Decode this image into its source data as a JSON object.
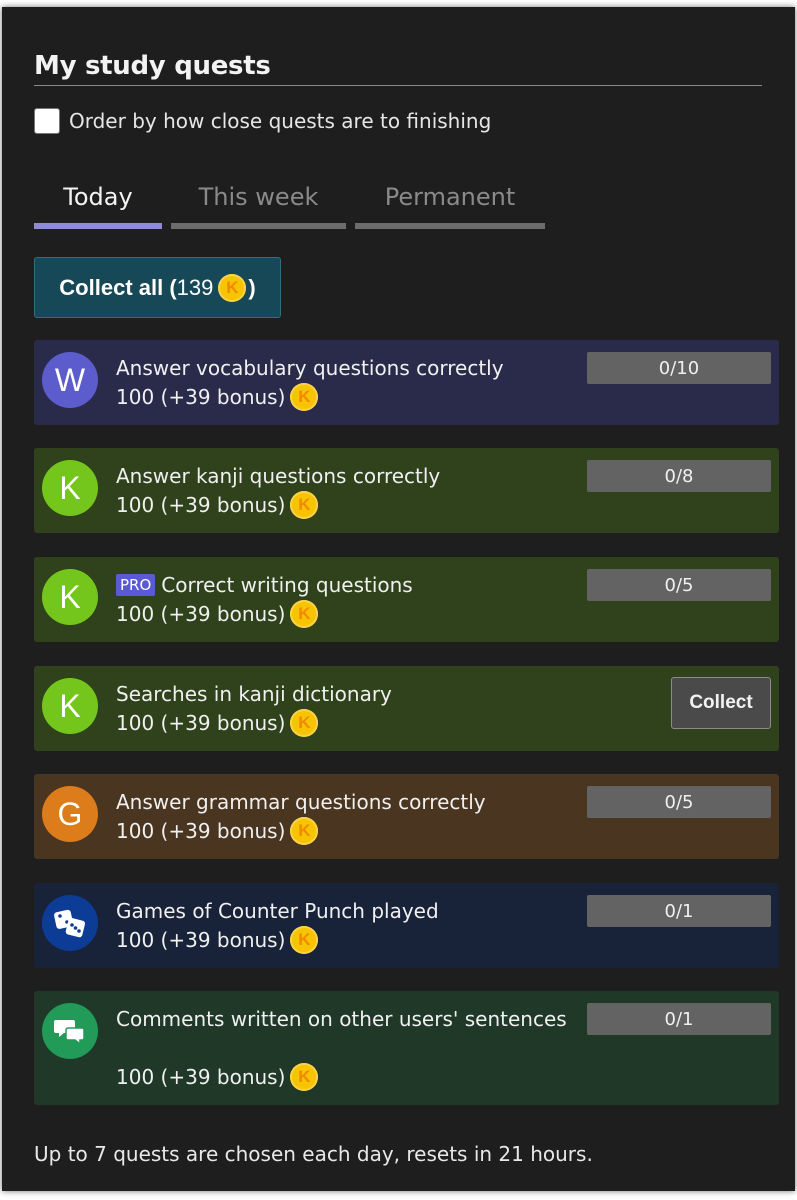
{
  "title": "My study quests",
  "order_label": "Order by how close quests are to finishing",
  "tabs": [
    {
      "label": "Today",
      "active": true
    },
    {
      "label": "This week",
      "active": false
    },
    {
      "label": "Permanent",
      "active": false
    }
  ],
  "collect_all": {
    "prefix": "Collect all (",
    "amount": "139",
    "suffix": ")"
  },
  "coin_letter": "K",
  "quests": [
    {
      "avatar": "W",
      "title": "Answer vocabulary questions correctly",
      "reward": "100 (+39 bonus)",
      "progress": "0/10",
      "pro": false
    },
    {
      "avatar": "K",
      "title": "Answer kanji questions correctly",
      "reward": "100 (+39 bonus)",
      "progress": "0/8",
      "pro": false
    },
    {
      "avatar": "K",
      "pro_label": "PRO",
      "title": "Correct writing questions",
      "reward": "100 (+39 bonus)",
      "progress": "0/5",
      "pro": true
    },
    {
      "avatar": "K",
      "title": "Searches in kanji dictionary",
      "reward": "100 (+39 bonus)",
      "button": "Collect",
      "pro": false
    },
    {
      "avatar": "G",
      "title": "Answer grammar questions correctly",
      "reward": "100 (+39 bonus)",
      "progress": "0/5",
      "pro": false
    },
    {
      "avatar_icon": "dice-icon",
      "title": "Games of Counter Punch played",
      "reward": "100 (+39 bonus)",
      "progress": "0/1",
      "pro": false
    },
    {
      "avatar_icon": "chat-bubbles-icon",
      "title": "Comments written on other users' sentences",
      "reward": "100 (+39 bonus)",
      "progress": "0/1",
      "pro": false
    }
  ],
  "footer": "Up to 7 quests are chosen each day, resets in 21 hours.",
  "colors": {
    "background": "#1e1e1e",
    "active_tab": "#8e8ad4",
    "vocab_card": "#2a2b4b",
    "kanji_card": "#2f421c",
    "grammar_card": "#4a3520",
    "game_card": "#182238",
    "comment_card": "#1f3828",
    "coin": "#f6c400"
  }
}
